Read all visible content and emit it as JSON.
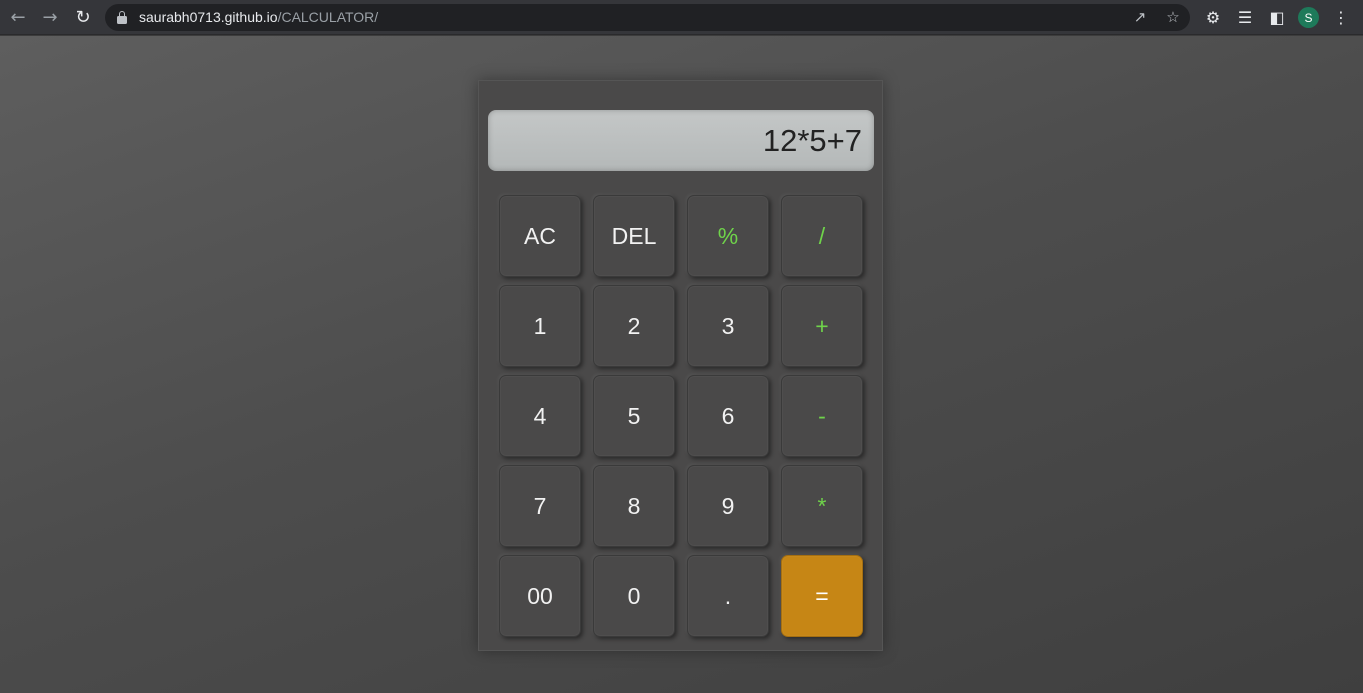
{
  "browser": {
    "url_domain": "saurabh0713.github.io",
    "url_path": "/CALCULATOR/",
    "profile_initial": "S"
  },
  "calculator": {
    "display_value": "12*5+7",
    "keys": [
      {
        "label": "AC",
        "type": "func",
        "name": "key-ac"
      },
      {
        "label": "DEL",
        "type": "func",
        "name": "key-del"
      },
      {
        "label": "%",
        "type": "op",
        "name": "key-percent"
      },
      {
        "label": "/",
        "type": "op",
        "name": "key-divide"
      },
      {
        "label": "1",
        "type": "num",
        "name": "key-1"
      },
      {
        "label": "2",
        "type": "num",
        "name": "key-2"
      },
      {
        "label": "3",
        "type": "num",
        "name": "key-3"
      },
      {
        "label": "+",
        "type": "op",
        "name": "key-plus"
      },
      {
        "label": "4",
        "type": "num",
        "name": "key-4"
      },
      {
        "label": "5",
        "type": "num",
        "name": "key-5"
      },
      {
        "label": "6",
        "type": "num",
        "name": "key-6"
      },
      {
        "label": "-",
        "type": "op",
        "name": "key-minus"
      },
      {
        "label": "7",
        "type": "num",
        "name": "key-7"
      },
      {
        "label": "8",
        "type": "num",
        "name": "key-8"
      },
      {
        "label": "9",
        "type": "num",
        "name": "key-9"
      },
      {
        "label": "*",
        "type": "op",
        "name": "key-multiply"
      },
      {
        "label": "00",
        "type": "num",
        "name": "key-00"
      },
      {
        "label": "0",
        "type": "num",
        "name": "key-0"
      },
      {
        "label": ".",
        "type": "num",
        "name": "key-decimal"
      },
      {
        "label": "=",
        "type": "eq",
        "name": "key-equals"
      }
    ]
  },
  "colors": {
    "operator": "#6fd34a",
    "equals_bg": "#c68615"
  }
}
